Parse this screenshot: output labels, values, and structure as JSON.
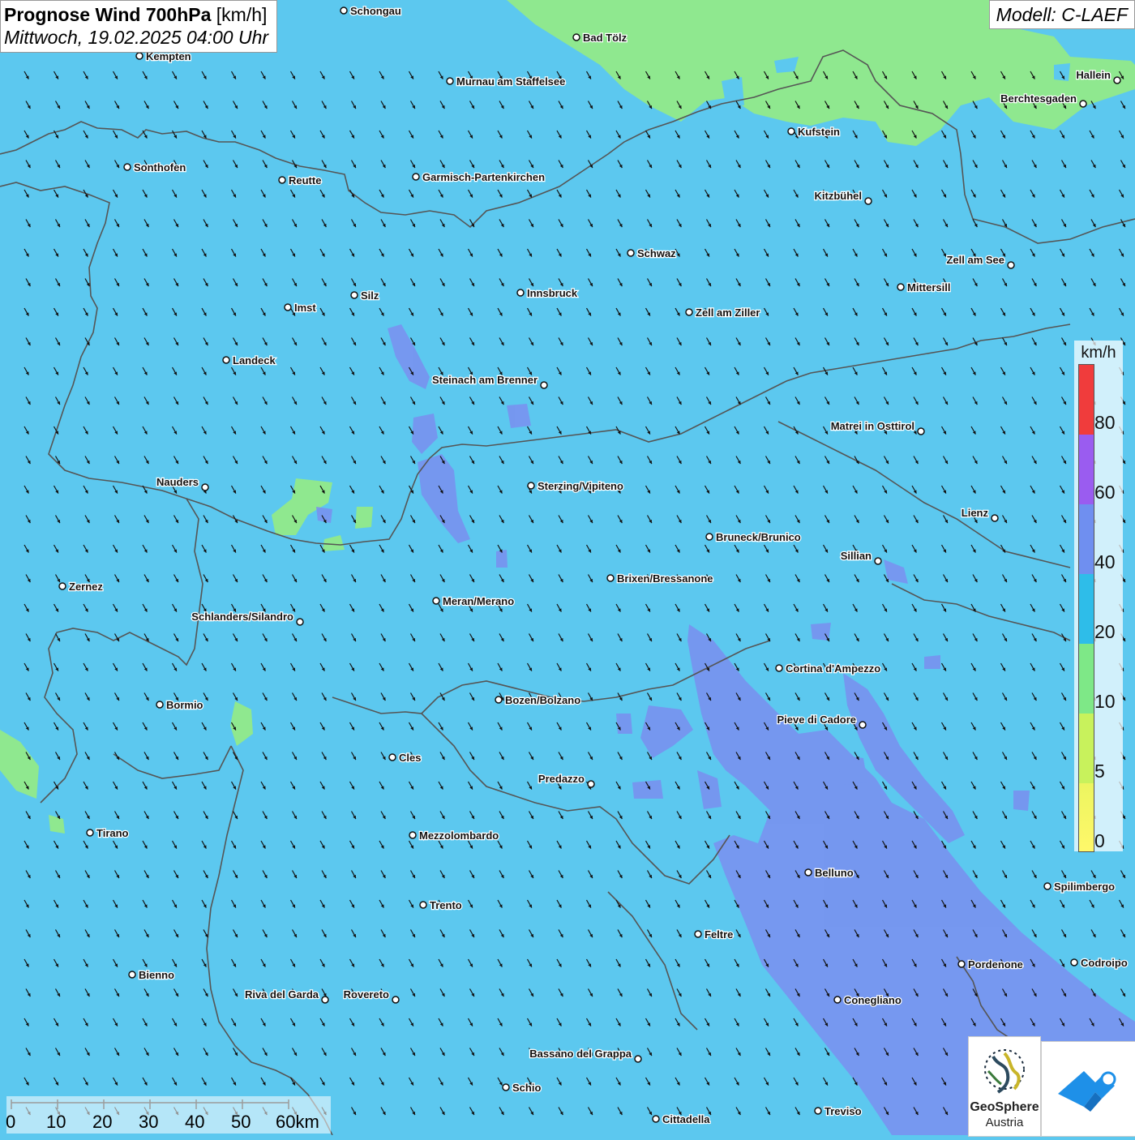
{
  "header": {
    "title_bold": "Prognose Wind 700hPa",
    "title_unit": "[km/h]",
    "datetime": "Mittwoch, 19.02.2025 04:00 Uhr",
    "model": "Modell: C-LAEF"
  },
  "legend": {
    "unit": "km/h",
    "entries": [
      {
        "label": "0",
        "color": "#fff86a"
      },
      {
        "label": "5",
        "color": "#c8f25c"
      },
      {
        "label": "10",
        "color": "#7ee887"
      },
      {
        "label": "20",
        "color": "#2ebde9"
      },
      {
        "label": "40",
        "color": "#6f8ff0"
      },
      {
        "label": "60",
        "color": "#9a5cf0"
      },
      {
        "label": "80",
        "color": "#f03c3c"
      }
    ]
  },
  "wind": {
    "direction": "from northwest (arrows point to southeast)",
    "dominant_class": "20-40 km/h"
  },
  "colors": {
    "class_20_40": "#5cc8ef",
    "class_10_20": "#8fe88f",
    "class_40_60": "#7a8ff0",
    "border": "#555555"
  },
  "scale": {
    "ticks": [
      "0",
      "10",
      "20",
      "30",
      "40",
      "50",
      "60km"
    ]
  },
  "logos": {
    "geosphere_line1": "GeoSphere",
    "geosphere_line2": "Austria",
    "geosphere_icon": "geosphere-logo-icon",
    "app_icon": "weather-app-cloud-icon"
  },
  "cities": [
    {
      "name": "Schongau"
    },
    {
      "name": "Bad Tölz"
    },
    {
      "name": "Kempten"
    },
    {
      "name": "Murnau am Staffelsee"
    },
    {
      "name": "Hallein"
    },
    {
      "name": "Berchtesgaden"
    },
    {
      "name": "Kufstein"
    },
    {
      "name": "Sonthofen"
    },
    {
      "name": "Reutte"
    },
    {
      "name": "Garmisch-Partenkirchen"
    },
    {
      "name": "Kitzbühel"
    },
    {
      "name": "Schwaz"
    },
    {
      "name": "Zell am See"
    },
    {
      "name": "Mittersill"
    },
    {
      "name": "Innsbruck"
    },
    {
      "name": "Silz"
    },
    {
      "name": "Imst"
    },
    {
      "name": "Zell am Ziller"
    },
    {
      "name": "Landeck"
    },
    {
      "name": "Steinach am Brenner"
    },
    {
      "name": "Matrei in Osttirol"
    },
    {
      "name": "Nauders"
    },
    {
      "name": "Sterzing/Vipiteno"
    },
    {
      "name": "Lienz"
    },
    {
      "name": "Bruneck/Brunico"
    },
    {
      "name": "Sillian"
    },
    {
      "name": "Zernez"
    },
    {
      "name": "Brixen/Bressanone"
    },
    {
      "name": "Meran/Merano"
    },
    {
      "name": "Schlanders/Silandro"
    },
    {
      "name": "Cortina d'Ampezzo"
    },
    {
      "name": "Bozen/Bolzano"
    },
    {
      "name": "Bormio"
    },
    {
      "name": "Pieve di Cadore"
    },
    {
      "name": "Cles"
    },
    {
      "name": "Predazzo"
    },
    {
      "name": "Tirano"
    },
    {
      "name": "Mezzolombardo"
    },
    {
      "name": "Belluno"
    },
    {
      "name": "Spilimbergo"
    },
    {
      "name": "Trento"
    },
    {
      "name": "Feltre"
    },
    {
      "name": "Bienno"
    },
    {
      "name": "Pordenone"
    },
    {
      "name": "Codroipo"
    },
    {
      "name": "Riva del Garda"
    },
    {
      "name": "Rovereto"
    },
    {
      "name": "Conegliano"
    },
    {
      "name": "Bassano del Grappa"
    },
    {
      "name": "Schio"
    },
    {
      "name": "Treviso"
    },
    {
      "name": "Cittadella"
    }
  ]
}
